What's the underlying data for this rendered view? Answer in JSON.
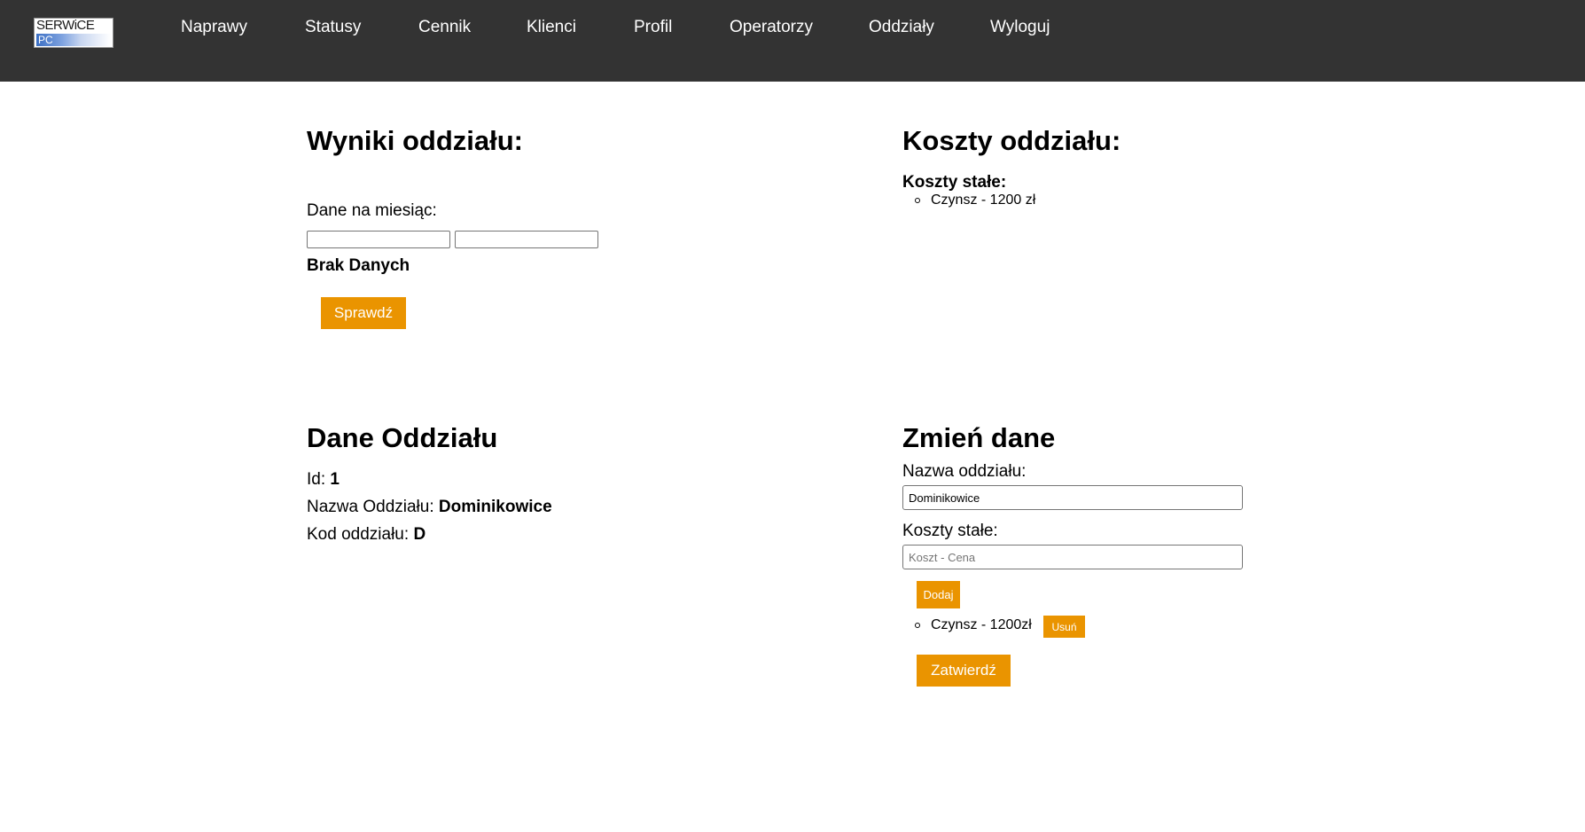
{
  "logo": {
    "top_text": "SERWiCE",
    "bottom_text": "PC"
  },
  "nav": {
    "items": [
      "Naprawy",
      "Statusy",
      "Cennik",
      "Klienci",
      "Profil",
      "Operatorzy",
      "Oddziały",
      "Wyloguj"
    ]
  },
  "results": {
    "title": "Wyniki oddziału:",
    "month_label": "Dane na miesiąc:",
    "date_from": "",
    "date_to": "",
    "status": "Brak Danych",
    "check_button": "Sprawdź"
  },
  "costs": {
    "title": "Koszty oddziału:",
    "fixed_label": "Koszty stałe:",
    "items": [
      "Czynsz - 1200 zł"
    ]
  },
  "branch": {
    "title": "Dane Oddziału",
    "id_label": "Id:",
    "id_value": "1",
    "name_label": "Nazwa Oddziału:",
    "name_value": "Dominikowice",
    "code_label": "Kod oddziału:",
    "code_value": "D"
  },
  "edit": {
    "title": "Zmień dane",
    "name_label": "Nazwa oddziału:",
    "name_value": "Dominikowice",
    "fixed_label": "Koszty stałe:",
    "cost_placeholder": "Koszt - Cena",
    "add_button": "Dodaj",
    "cost_items": [
      {
        "text": "Czynsz - 1200zł",
        "remove_label": "Usuń"
      }
    ],
    "confirm_button": "Zatwierdź"
  },
  "colors": {
    "navbar": "#333333",
    "accent": "#ea9400",
    "background": "#ffffff"
  }
}
